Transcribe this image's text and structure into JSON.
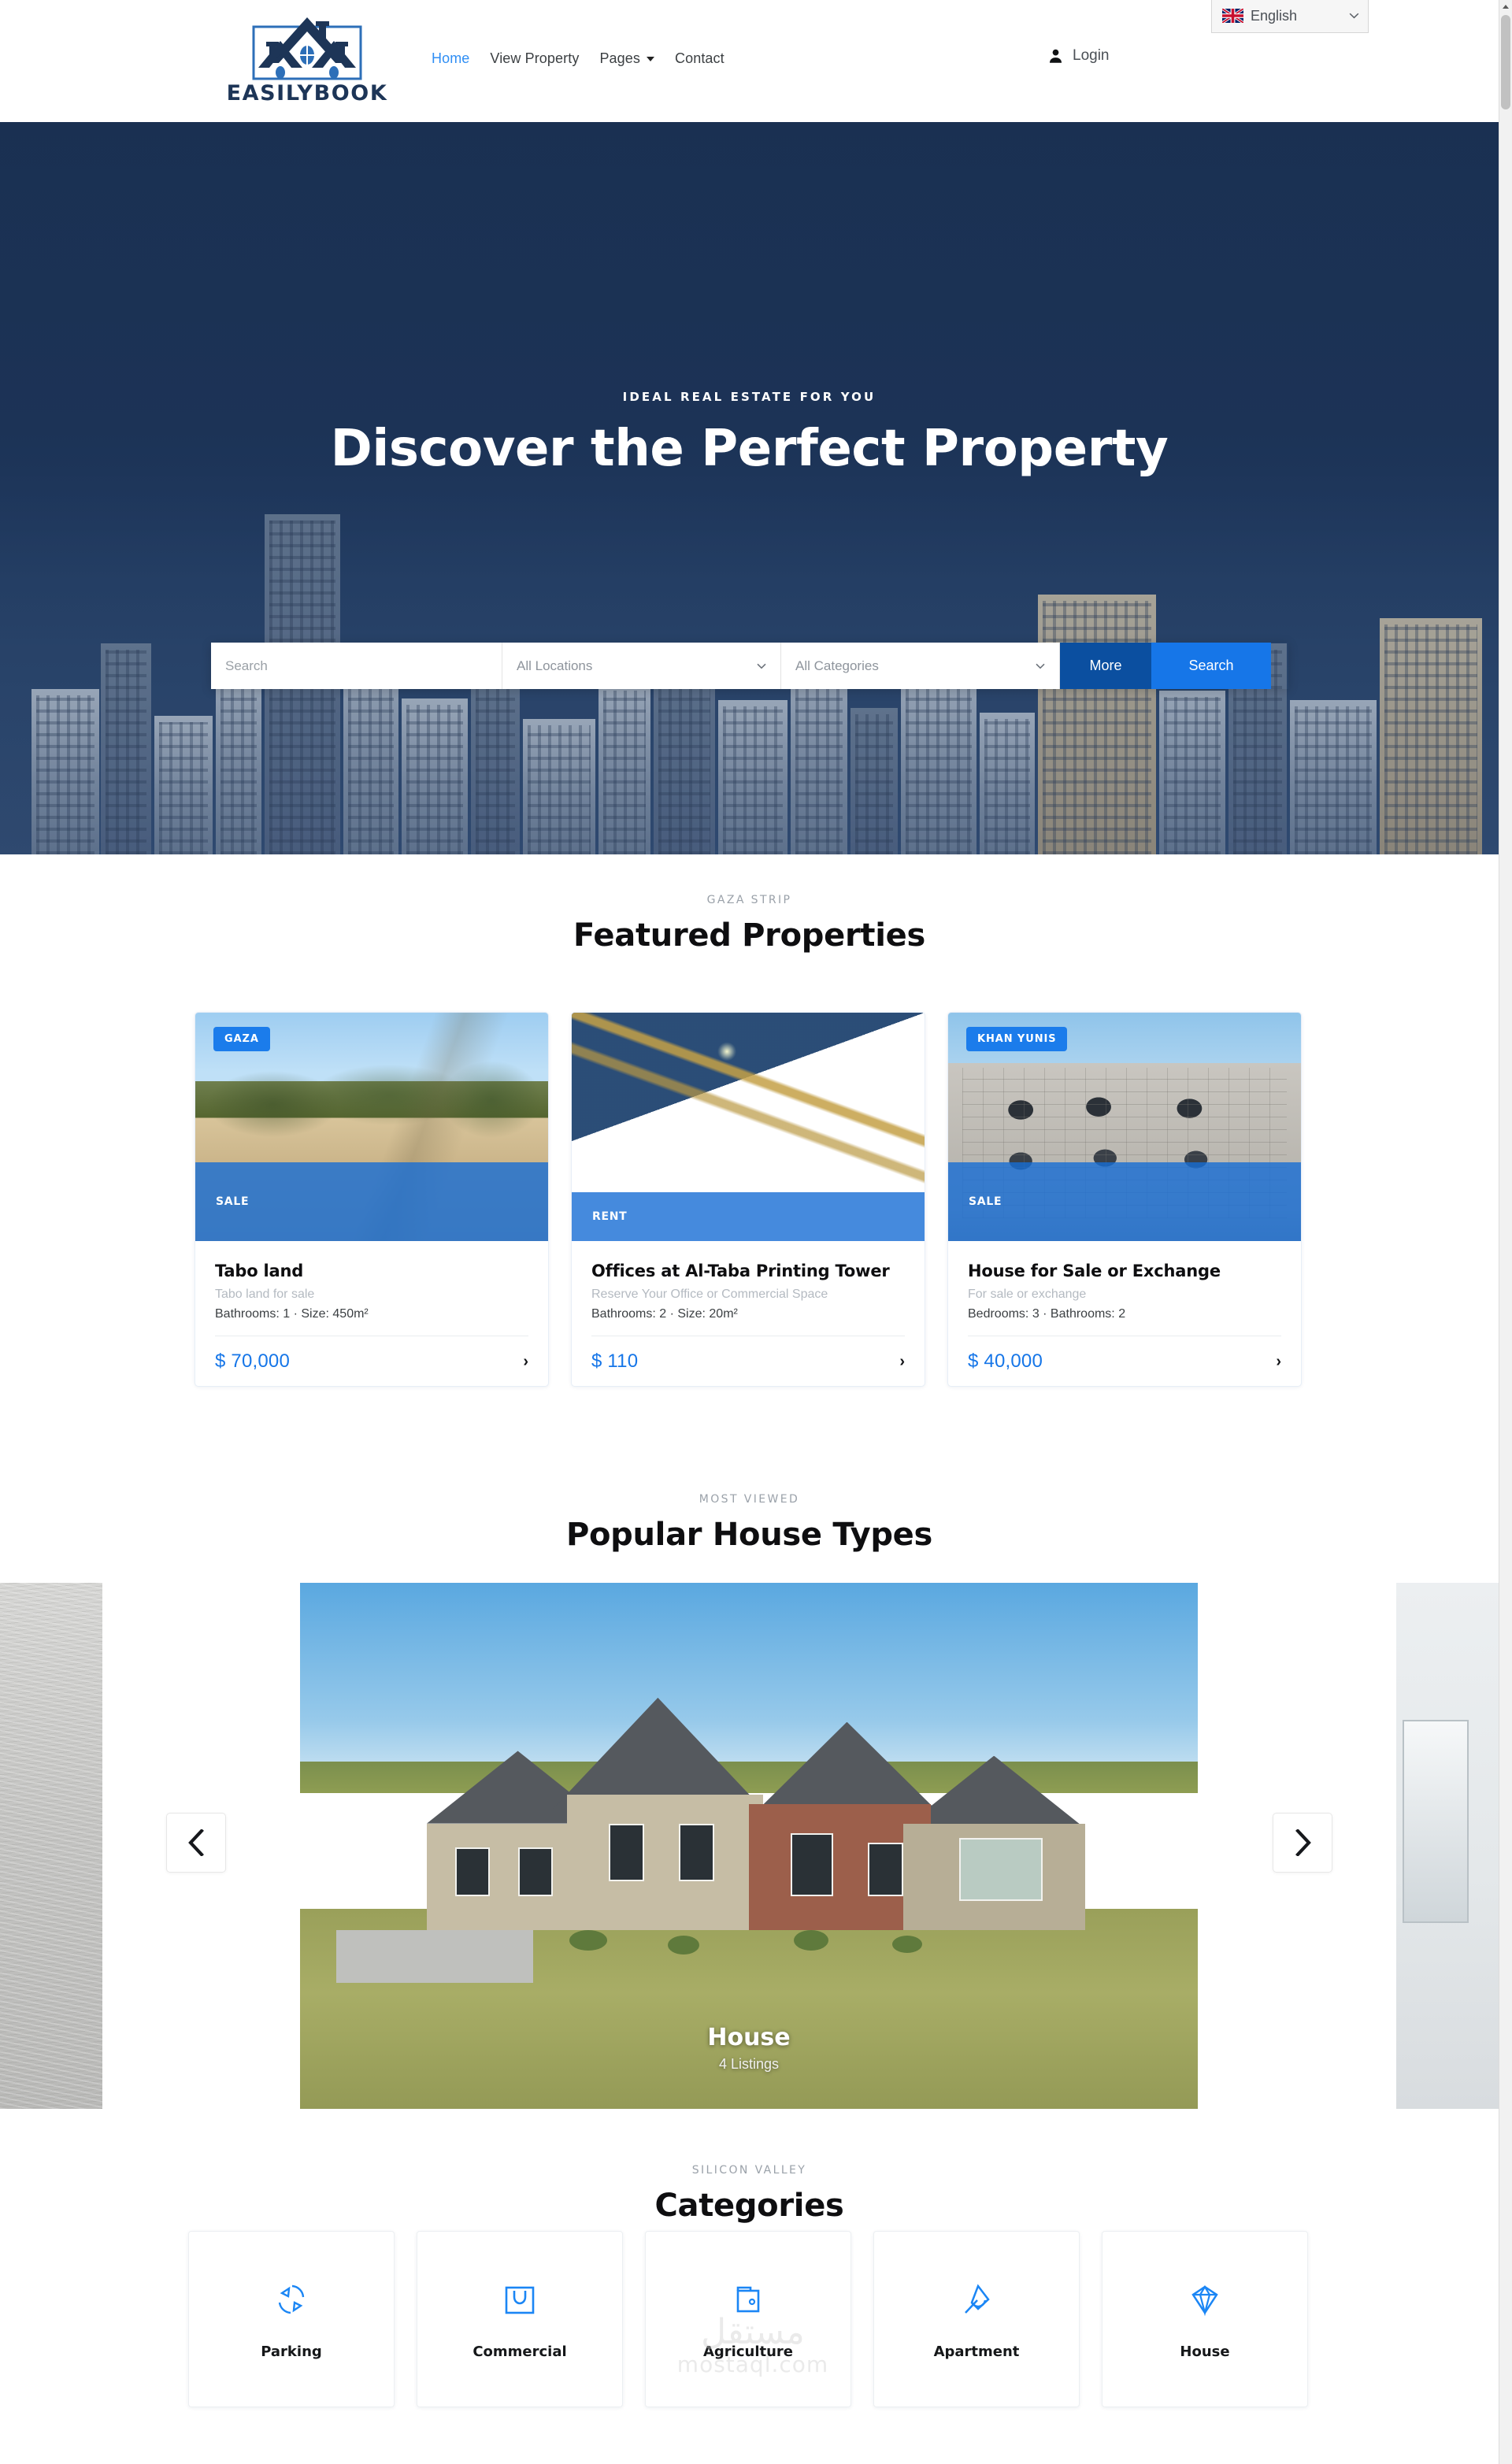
{
  "header": {
    "logo_text": "EASILYBOOK",
    "nav": [
      {
        "label": "Home",
        "active": true
      },
      {
        "label": "View Property",
        "active": false
      },
      {
        "label": "Pages",
        "active": false,
        "has_dropdown": true
      },
      {
        "label": "Contact",
        "active": false
      }
    ],
    "login_label": "Login",
    "login_icon": "person-icon",
    "language": {
      "label": "English",
      "flag_icon": "uk-flag-icon",
      "chevron_icon": "chevron-down-icon"
    }
  },
  "hero": {
    "eyebrow": "IDEAL REAL ESTATE FOR YOU",
    "title": "Discover the Perfect Property",
    "search": {
      "keyword_placeholder": "Search",
      "keyword_value": "",
      "location_label": "All Locations",
      "category_label": "All Categories",
      "more_label": "More",
      "search_label": "Search"
    }
  },
  "featured": {
    "eyebrow": "GAZA STRIP",
    "title": "Featured Properties",
    "cards": [
      {
        "location_badge": "GAZA",
        "status_tag": "SALE",
        "title": "Tabo land",
        "subtitle": "Tabo land for sale",
        "meta": "Bathrooms: 1  ·  Size: 450m²",
        "price": "$ 70,000",
        "arrow_icon": "chevron-right-icon"
      },
      {
        "location_badge": "",
        "status_tag": "RENT",
        "title": "Offices at Al-Taba Printing Tower",
        "subtitle": "Reserve Your Office or Commercial Space",
        "meta": "Bathrooms: 2  ·  Size: 20m²",
        "price": "$ 110",
        "arrow_icon": "chevron-right-icon"
      },
      {
        "location_badge": "KHAN YUNIS",
        "status_tag": "SALE",
        "title": "House for Sale or Exchange",
        "subtitle": "For sale or exchange",
        "meta": "Bedrooms: 3  ·  Bathrooms: 2",
        "price": "$ 40,000",
        "arrow_icon": "chevron-right-icon"
      }
    ]
  },
  "popular": {
    "eyebrow": "MOST VIEWED",
    "title": "Popular House Types",
    "slide": {
      "caption_title": "House",
      "caption_sub": "4 Listings"
    },
    "prev_icon": "chevron-left-icon",
    "next_icon": "chevron-right-icon"
  },
  "categories": {
    "eyebrow": "SILICON VALLEY",
    "title": "Categories",
    "items": [
      {
        "label": "Parking",
        "icon": "refresh-arrows-icon"
      },
      {
        "label": "Commercial",
        "icon": "shopping-bag-icon"
      },
      {
        "label": "Agriculture",
        "icon": "briefcase-icon"
      },
      {
        "label": "Apartment",
        "icon": "leaf-icon"
      },
      {
        "label": "House",
        "icon": "diamond-icon"
      }
    ]
  },
  "watermark": {
    "arabic": "مستقل",
    "url": "mostaql.com"
  },
  "colors": {
    "accent_blue": "#1676e8",
    "deep_blue": "#0b4fa0",
    "logo_navy": "#1d3557",
    "text_dark": "#0e0e10",
    "muted": "#9aa1a9"
  }
}
